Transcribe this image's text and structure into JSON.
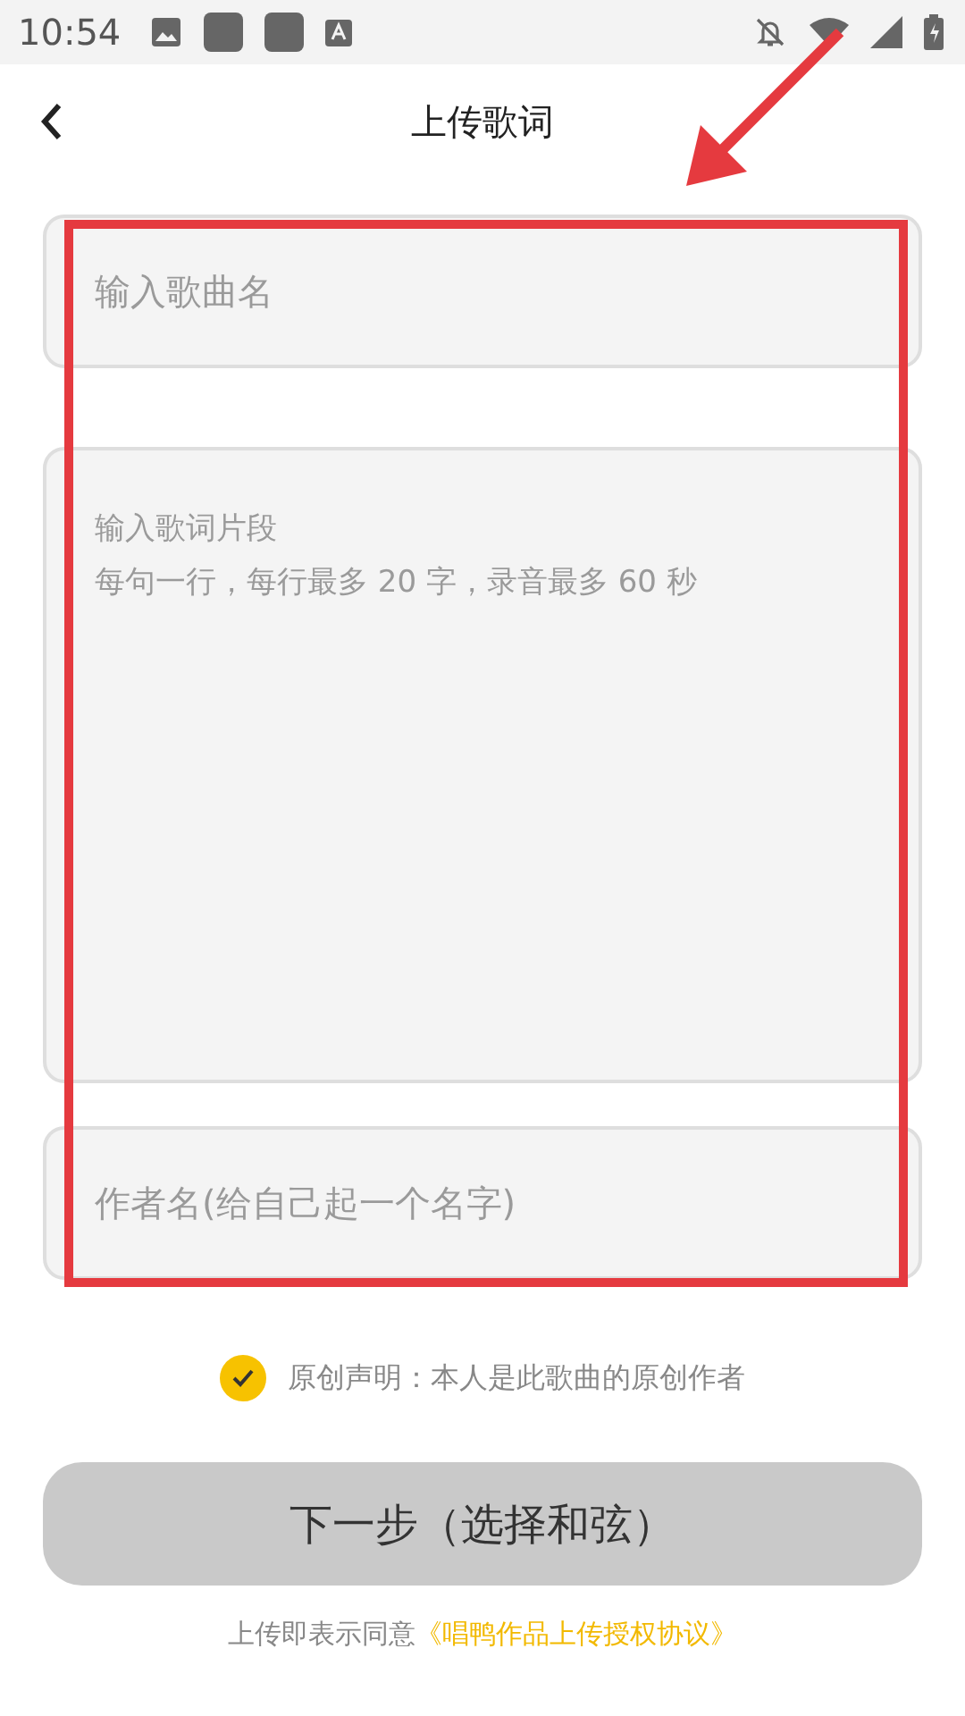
{
  "status_bar": {
    "time": "10:54"
  },
  "header": {
    "title": "上传歌词"
  },
  "fields": [
    {
      "kind": "input",
      "placeholder": "输入歌曲名"
    },
    {
      "kind": "textarea",
      "placeholder": "输入歌词片段",
      "hint": "每句一行，每行最多 20 字，录音最多 60 秒"
    },
    {
      "kind": "input",
      "placeholder": "作者名(给自己起一个名字)"
    }
  ],
  "declaration": {
    "checked": true,
    "label": "原创声明：本人是此歌曲的原创作者"
  },
  "next_button": {
    "label": "下一步（选择和弦）",
    "disabled": true
  },
  "agreement": {
    "text": "上传即表示同意",
    "link": "《唱鸭作品上传授权协议》"
  }
}
